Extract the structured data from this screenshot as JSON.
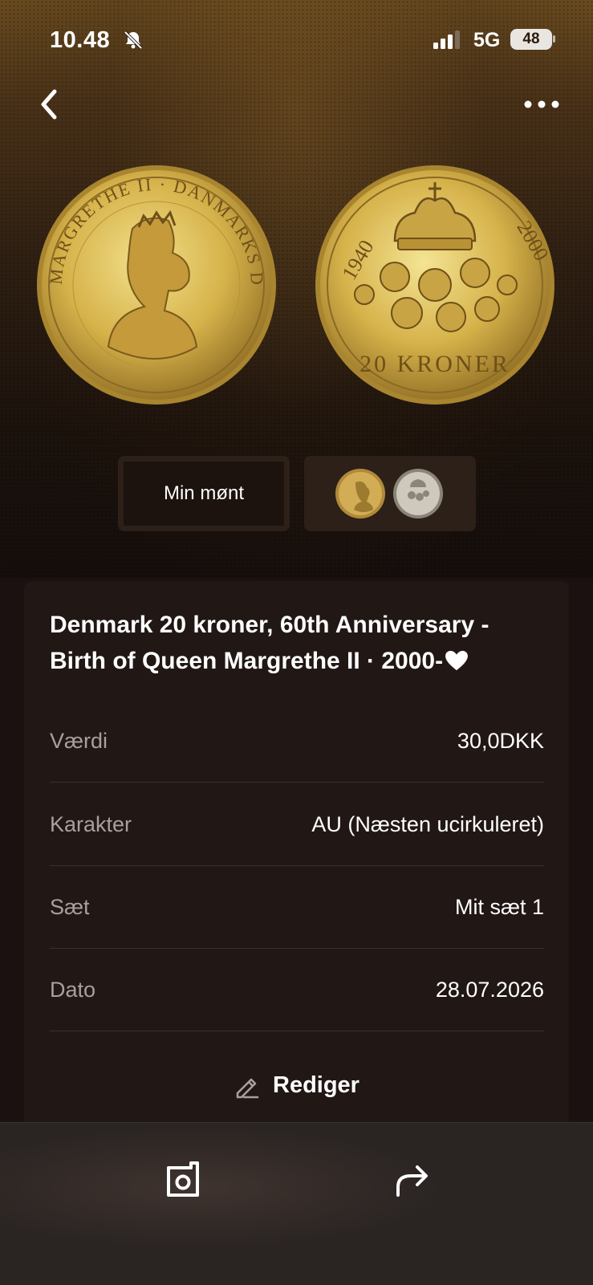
{
  "status_bar": {
    "time": "10.48",
    "network": "5G",
    "battery": "48"
  },
  "nav": {
    "back_icon": "chevron-left-icon",
    "more_icon": "ellipsis-icon"
  },
  "tabs": {
    "my_coin_label": "Min mønt"
  },
  "coin": {
    "title": "Denmark 20 kroner, 60th Anniversary - Birth of Queen Margrethe II · 2000-",
    "favorite_icon": "heart-icon",
    "details": [
      {
        "key": "Værdi",
        "value": "30,0DKK"
      },
      {
        "key": "Karakter",
        "value": "AU (Næsten ucirkuleret)"
      },
      {
        "key": "Sæt",
        "value": "Mit sæt 1"
      },
      {
        "key": "Dato",
        "value": "28.07.2026"
      }
    ],
    "edit_label": "Rediger",
    "obverse_legend": "MARGRETHE II · DANMARKS DRONNING",
    "reverse_legend": [
      "1940",
      "2000",
      "20 KRONER"
    ]
  },
  "bottom_bar": {
    "photo_icon": "camera-photo-icon",
    "share_icon": "share-arrow-icon"
  },
  "colors": {
    "card_bg": "#211714",
    "gold": "#d6b24a",
    "label_gray": "#a8a09c"
  }
}
